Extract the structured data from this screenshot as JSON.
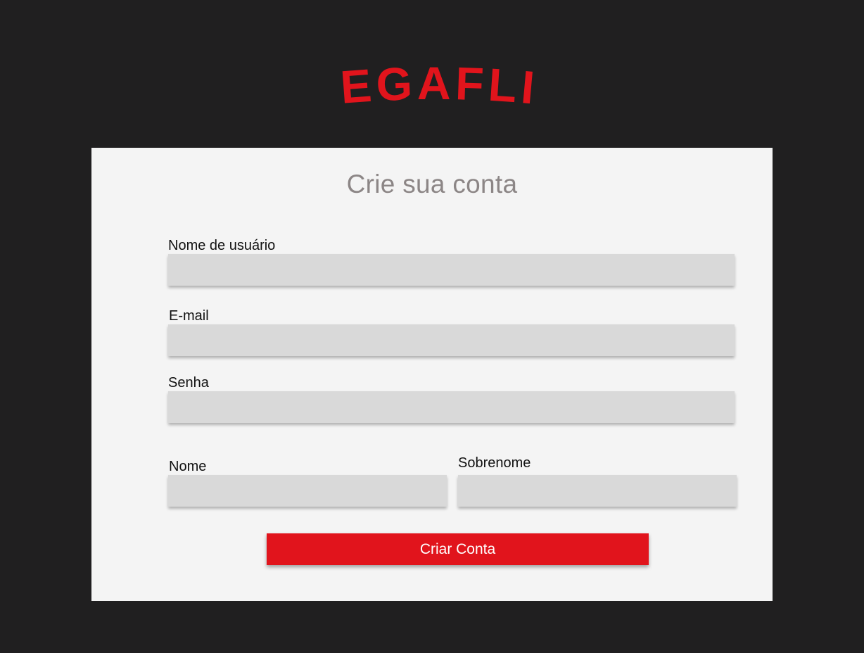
{
  "brand": {
    "name": "MEGAFLIX",
    "color": "#e1141c"
  },
  "form": {
    "title": "Crie sua conta",
    "fields": {
      "username": {
        "label": "Nome de usuário",
        "value": "",
        "placeholder": ""
      },
      "email": {
        "label": "E-mail",
        "value": "",
        "placeholder": ""
      },
      "password": {
        "label": "Senha",
        "value": "",
        "placeholder": ""
      },
      "first_name": {
        "label": "Nome",
        "value": "",
        "placeholder": ""
      },
      "last_name": {
        "label": "Sobrenome",
        "value": "",
        "placeholder": ""
      }
    },
    "submit_label": "Criar Conta"
  },
  "colors": {
    "background": "#201f20",
    "card": "#f4f4f4",
    "input": "#d9d9d9",
    "title_text": "#8c8686",
    "button": "#e1141c"
  }
}
